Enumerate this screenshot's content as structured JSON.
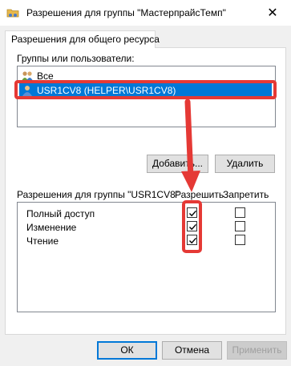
{
  "window": {
    "title": "Разрешения для группы \"МастерпрайсТемп\"",
    "close_glyph": "✕"
  },
  "tabs": [
    {
      "label": "Разрешения для общего ресурса",
      "active": true
    }
  ],
  "groups": {
    "label": "Группы или пользователи:",
    "items": [
      {
        "label": "Все",
        "icon": "group-icon",
        "selected": false
      },
      {
        "label": "USR1CV8 (HELPER\\USR1CV8)",
        "icon": "user-icon",
        "selected": true
      }
    ],
    "add_button": "Добавить...",
    "remove_button": "Удалить"
  },
  "permissions": {
    "label": "Разрешения для группы \"USR1CV8\"",
    "allow_header": "Разрешить",
    "deny_header": "Запретить",
    "rows": [
      {
        "name": "Полный доступ",
        "allow": true,
        "deny": false
      },
      {
        "name": "Изменение",
        "allow": true,
        "deny": false
      },
      {
        "name": "Чтение",
        "allow": true,
        "deny": false
      }
    ]
  },
  "footer": {
    "ok": "ОК",
    "cancel": "Отмена",
    "apply": "Применить"
  },
  "colors": {
    "selection": "#0078d7",
    "highlight": "#e53935"
  }
}
